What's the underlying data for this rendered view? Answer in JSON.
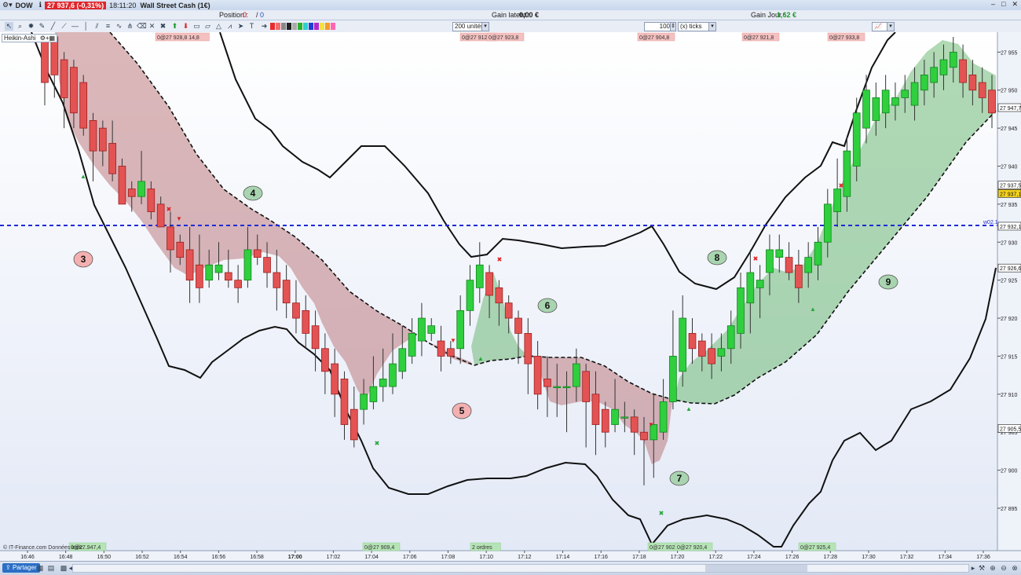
{
  "titlebar": {
    "app_menu": "DOW",
    "price_chip": "27 937,6 (-0,31%)",
    "time": "18:11:20",
    "instrument": "Wall Street Cash (1€)",
    "window_buttons": [
      "–",
      "□",
      "✕"
    ]
  },
  "posbar": {
    "position_label": "Position :",
    "position_value": "0",
    "position_sep": "/",
    "position_orders": "0",
    "latent_label": "Gain latent :",
    "latent_value": "0,00 €",
    "day_label": "Gain Jour :",
    "day_value": "1,62 €",
    "day_color": "#1c9a2c"
  },
  "toolbar": {
    "units_value": "200 unités",
    "qty_value": "100",
    "ticks_value": "(x) ticks"
  },
  "chart_header": {
    "heikin_label": "Heikin-Ashi"
  },
  "statusbar": {
    "share_label": "Partager",
    "copyright": "© IT-Finance.com  Données indic..."
  },
  "chart_data": {
    "type": "candlestick",
    "y_ticks": [
      "27 955",
      "27 950",
      "27 945",
      "27 940",
      "27 935",
      "27 930",
      "27 925",
      "27 920",
      "27 915",
      "27 910",
      "27 905",
      "27 900",
      "27 895"
    ],
    "x_ticks": [
      "16:46",
      "16:48",
      "16:50",
      "16:52",
      "16:54",
      "16:56",
      "16:58",
      "17:00",
      "17:02",
      "17:04",
      "17:06",
      "17:08",
      "17:10",
      "17:12",
      "17:14",
      "17:16",
      "17:18",
      "17:20",
      "17:22",
      "17:24",
      "17:26",
      "17:28",
      "17:30",
      "17:32",
      "17:34",
      "17:36"
    ],
    "ylim": [
      27892,
      27957
    ],
    "price_markers": [
      {
        "label": "27 947,7",
        "value": 27947.7
      },
      {
        "label": "27 937,5",
        "value": 27937.5
      },
      {
        "label": "27 937,1",
        "value": 27936.4
      },
      {
        "label": "27 932,1",
        "value": 27932.1
      },
      {
        "label": "27 926,6",
        "value": 27926.6
      },
      {
        "label": "27 905,5",
        "value": 27905.5
      }
    ],
    "horizontal_line": {
      "value": 27932.1,
      "label": "w02.1",
      "color": "#1f2bd6"
    },
    "top_labels": [
      "0@27 928,8 14,8",
      "0@27 912,8",
      "0@27 923,8",
      "0@27 904,8",
      "0@27 921,8",
      "0@27 933,8"
    ],
    "bottom_labels": [
      "0@27 947,4",
      "0@27 909,4",
      "2 ordres",
      "0@27 902,9",
      "0@27 920,4",
      "0@27 925,4"
    ],
    "wave_labels": [
      {
        "text": "3",
        "style": "red"
      },
      {
        "text": "4",
        "style": "green"
      },
      {
        "text": "5",
        "style": "red"
      },
      {
        "text": "6",
        "style": "green"
      },
      {
        "text": "7",
        "style": "green"
      },
      {
        "text": "8",
        "style": "green"
      },
      {
        "text": "9",
        "style": "green"
      }
    ],
    "candles": [
      [
        27957,
        27951,
        27956,
        27948
      ],
      [
        27957,
        27952,
        27956,
        27949
      ],
      [
        27954,
        27949,
        27955,
        27945
      ],
      [
        27953,
        27947,
        27954,
        27945
      ],
      [
        27951,
        27945,
        27952,
        27944
      ],
      [
        27946,
        27942,
        27947,
        27938
      ],
      [
        27945,
        27942,
        27946,
        27940
      ],
      [
        27943,
        27939,
        27946,
        27938
      ],
      [
        27940,
        27935,
        27941,
        27935
      ],
      [
        27937,
        27936,
        27938,
        27934
      ],
      [
        27936,
        27938,
        27942,
        27935
      ],
      [
        27937,
        27934,
        27938,
        27933
      ],
      [
        27935,
        27932,
        27936,
        27932
      ],
      [
        27932,
        27929,
        27934,
        27926
      ],
      [
        27930,
        27928,
        27931,
        27927
      ],
      [
        27929,
        27925,
        27932,
        27922
      ],
      [
        27927,
        27924,
        27931,
        27922
      ],
      [
        27925,
        27927,
        27929,
        27924
      ],
      [
        27926,
        27927,
        27930,
        27925
      ],
      [
        27926,
        27925,
        27929,
        27924
      ],
      [
        27925,
        27924,
        27927,
        27922
      ],
      [
        27925,
        27929,
        27932,
        27924
      ],
      [
        27929,
        27928,
        27931,
        27927
      ],
      [
        27928,
        27926,
        27930,
        27924
      ],
      [
        27926,
        27924,
        27929,
        27921
      ],
      [
        27925,
        27922,
        27927,
        27920
      ],
      [
        27922,
        27920,
        27925,
        27918
      ],
      [
        27921,
        27918,
        27923,
        27916
      ],
      [
        27919,
        27916,
        27921,
        27913
      ],
      [
        27916,
        27913,
        27918,
        27910
      ],
      [
        27914,
        27910,
        27916,
        27907
      ],
      [
        27912,
        27906,
        27913,
        27904
      ],
      [
        27908,
        27904,
        27911,
        27903
      ],
      [
        27908,
        27910,
        27912,
        27906
      ],
      [
        27909,
        27911,
        27915,
        27908
      ],
      [
        27911,
        27912,
        27916,
        27909
      ],
      [
        27911,
        27914,
        27918,
        27910
      ],
      [
        27913,
        27916,
        27919,
        27912
      ],
      [
        27915,
        27918,
        27920,
        27914
      ],
      [
        27917,
        27920,
        27922,
        27915
      ],
      [
        27918,
        27919,
        27920,
        27917
      ],
      [
        27917,
        27915,
        27919,
        27913
      ],
      [
        27916,
        27915,
        27917,
        27914
      ],
      [
        27916,
        27921,
        27923,
        27914
      ],
      [
        27921,
        27925,
        27927,
        27919
      ],
      [
        27924,
        27927,
        27930,
        27922
      ],
      [
        27926,
        27923,
        27927,
        27920
      ],
      [
        27924,
        27922,
        27925,
        27919
      ],
      [
        27922,
        27920,
        27923,
        27918
      ],
      [
        27920,
        27918,
        27921,
        27914
      ],
      [
        27918,
        27914,
        27920,
        27910
      ],
      [
        27915,
        27910,
        27917,
        27908
      ],
      [
        27912,
        27911,
        27915,
        27907
      ],
      [
        27911,
        27911,
        27914,
        27907
      ],
      [
        27911,
        27911,
        27913,
        27905
      ],
      [
        27911,
        27914,
        27916,
        27909
      ],
      [
        27913,
        27909,
        27914,
        27903
      ],
      [
        27910,
        27906,
        27913,
        27902
      ],
      [
        27908,
        27905,
        27909,
        27903
      ],
      [
        27906,
        27908,
        27912,
        27905
      ],
      [
        27907,
        27907,
        27909,
        27905
      ],
      [
        27907,
        27905,
        27908,
        27902
      ],
      [
        27905,
        27904,
        27907,
        27898
      ],
      [
        27904,
        27906,
        27910,
        27899
      ],
      [
        27905,
        27909,
        27912,
        27904
      ],
      [
        27909,
        27915,
        27921,
        27908
      ],
      [
        27913,
        27920,
        27923,
        27911
      ],
      [
        27918,
        27916,
        27920,
        27914
      ],
      [
        27917,
        27915,
        27918,
        27913
      ],
      [
        27916,
        27914,
        27918,
        27912
      ],
      [
        27915,
        27916,
        27918,
        27913
      ],
      [
        27916,
        27919,
        27921,
        27914
      ],
      [
        27918,
        27924,
        27926,
        27916
      ],
      [
        27922,
        27926,
        27929,
        27918
      ],
      [
        27924,
        27925,
        27927,
        27920
      ],
      [
        27926,
        27929,
        27931,
        27923
      ],
      [
        27928,
        27929,
        27931,
        27926
      ],
      [
        27928,
        27926,
        27930,
        27925
      ],
      [
        27927,
        27924,
        27929,
        27922
      ],
      [
        27926,
        27928,
        27930,
        27924
      ],
      [
        27927,
        27930,
        27932,
        27925
      ],
      [
        27930,
        27935,
        27937,
        27928
      ],
      [
        27934,
        27937,
        27941,
        27932
      ],
      [
        27936,
        27942,
        27944,
        27934
      ],
      [
        27940,
        27947,
        27949,
        27938
      ],
      [
        27945,
        27950,
        27952,
        27943
      ],
      [
        27946,
        27949,
        27951,
        27944
      ],
      [
        27947,
        27950,
        27952,
        27945
      ],
      [
        27948,
        27949,
        27951,
        27946
      ],
      [
        27949,
        27950,
        27952,
        27947
      ],
      [
        27948,
        27951,
        27953,
        27946
      ],
      [
        27950,
        27952,
        27954,
        27948
      ],
      [
        27951,
        27953,
        27955,
        27949
      ],
      [
        27952,
        27954,
        27956,
        27950
      ],
      [
        27953,
        27955,
        27957,
        27951
      ],
      [
        27954,
        27951,
        27956,
        27949
      ],
      [
        27952,
        27950,
        27954,
        27948
      ],
      [
        27951,
        27949,
        27953,
        27947
      ],
      [
        27950,
        27947,
        27952,
        27945
      ]
    ]
  }
}
